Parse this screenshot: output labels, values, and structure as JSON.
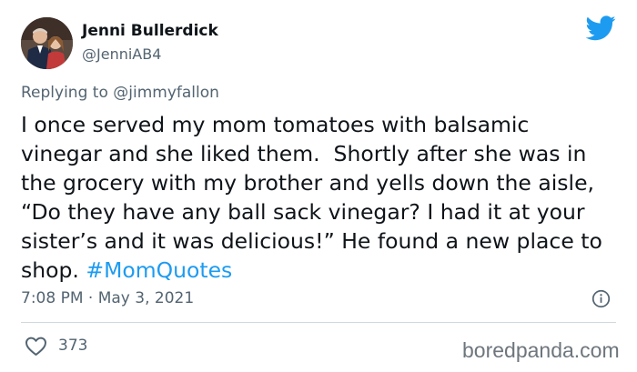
{
  "author": {
    "name": "Jenni Bullerdick",
    "handle": "@JenniAB4"
  },
  "reply": {
    "prefix": "Replying to ",
    "mention": "@jimmyfallon"
  },
  "tweet": {
    "text": "I once served my mom tomatoes with balsamic vinegar and she liked them.  Shortly after she was in the grocery with my brother and yells down the aisle, “Do they have any ball sack vinegar? I had it at your sister’s and it was delicious!” He found a new place to shop. ",
    "hashtag": "#MomQuotes"
  },
  "meta": {
    "timestamp": "7:08 PM · May 3, 2021",
    "likes": "373"
  },
  "watermark": "boredpanda.com",
  "colors": {
    "brand": "#1d9bf0",
    "text": "#0f1419",
    "secondary": "#536471"
  },
  "icons": [
    "twitter-bird-icon",
    "info-icon",
    "heart-icon"
  ]
}
